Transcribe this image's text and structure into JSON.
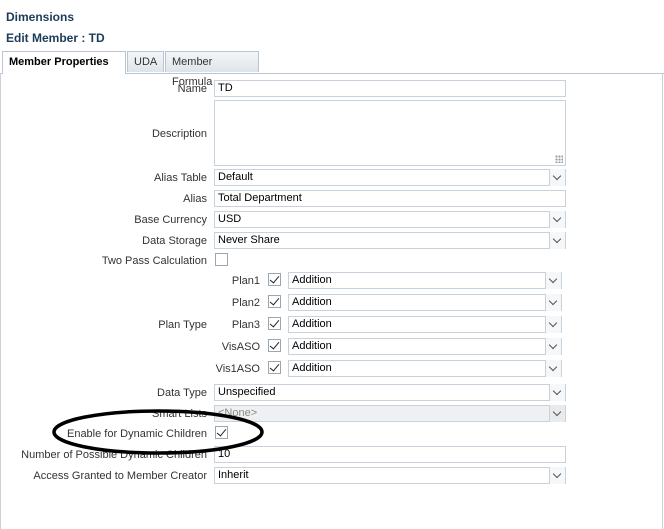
{
  "header": {
    "title": "Dimensions",
    "subtitle": "Edit Member : TD"
  },
  "tabs": [
    {
      "label": "Member Properties",
      "active": true
    },
    {
      "label": "UDA",
      "active": false
    },
    {
      "label": "Member Formula",
      "active": false
    }
  ],
  "form": {
    "name": {
      "label": "Name",
      "value": "TD"
    },
    "description": {
      "label": "Description",
      "value": ""
    },
    "alias_table": {
      "label": "Alias Table",
      "value": "Default"
    },
    "alias": {
      "label": "Alias",
      "value": "Total Department"
    },
    "base_currency": {
      "label": "Base Currency",
      "value": "USD"
    },
    "data_storage": {
      "label": "Data Storage",
      "value": "Never Share"
    },
    "two_pass": {
      "label": "Two Pass Calculation",
      "checked": false
    },
    "plan_type": {
      "label": "Plan Type",
      "plans": [
        {
          "name": "Plan1",
          "checked": true,
          "agg": "Addition"
        },
        {
          "name": "Plan2",
          "checked": true,
          "agg": "Addition"
        },
        {
          "name": "Plan3",
          "checked": true,
          "agg": "Addition"
        },
        {
          "name": "VisASO",
          "checked": true,
          "agg": "Addition"
        },
        {
          "name": "Vis1ASO",
          "checked": true,
          "agg": "Addition"
        }
      ]
    },
    "data_type": {
      "label": "Data Type",
      "value": "Unspecified"
    },
    "smart_lists": {
      "label": "Smart Lists",
      "value": "<None>"
    },
    "dynamic_children": {
      "label": "Enable for Dynamic Children",
      "checked": true
    },
    "possible_dynamic": {
      "label": "Number of Possible Dynamic Children",
      "value": "10"
    },
    "access_granted": {
      "label": "Access Granted to Member Creator",
      "value": "Inherit"
    }
  },
  "annotation": {
    "shape": "ellipse",
    "color": "#000000"
  }
}
